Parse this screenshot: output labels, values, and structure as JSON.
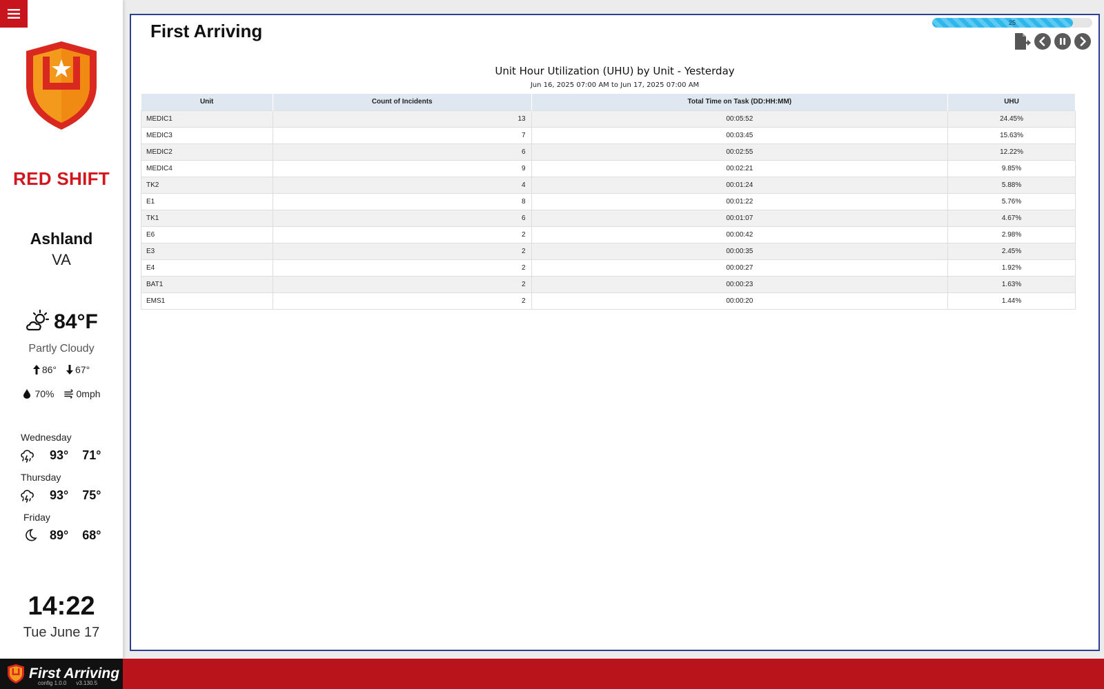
{
  "sidebar": {
    "shift": "RED SHIFT",
    "city": "Ashland",
    "state": "VA",
    "weather": {
      "temp": "84°F",
      "condition": "Partly Cloudy",
      "high": "86°",
      "low": "67°",
      "humidity": "70%",
      "wind": "0mph",
      "icon": "partly-cloudy-day-icon"
    },
    "forecast": [
      {
        "day": "Wednesday",
        "high": "93°",
        "low": "71°",
        "icon": "thunderstorm-icon"
      },
      {
        "day": "Thursday",
        "high": "93°",
        "low": "75°",
        "icon": "thunderstorm-icon"
      },
      {
        "day": "Friday",
        "high": "89°",
        "low": "68°",
        "icon": "moon-icon"
      }
    ],
    "time": "14:22",
    "date": "Tue June 17"
  },
  "header": {
    "title": "First Arriving",
    "progress_value": "25",
    "progress_fraction": 0.88
  },
  "report": {
    "title": "Unit Hour Utilization (UHU) by Unit - Yesterday",
    "subtitle": "Jun 16, 2025 07:00 AM to Jun 17, 2025 07:00 AM",
    "columns": [
      "Unit",
      "Count of Incidents",
      "Total Time on Task (DD:HH:MM)",
      "UHU"
    ],
    "rows": [
      [
        "MEDIC1",
        "13",
        "00:05:52",
        "24.45%"
      ],
      [
        "MEDIC3",
        "7",
        "00:03:45",
        "15.63%"
      ],
      [
        "MEDIC2",
        "6",
        "00:02:55",
        "12.22%"
      ],
      [
        "MEDIC4",
        "9",
        "00:02:21",
        "9.85%"
      ],
      [
        "TK2",
        "4",
        "00:01:24",
        "5.88%"
      ],
      [
        "E1",
        "8",
        "00:01:22",
        "5.76%"
      ],
      [
        "TK1",
        "6",
        "00:01:07",
        "4.67%"
      ],
      [
        "E6",
        "2",
        "00:00:42",
        "2.98%"
      ],
      [
        "E3",
        "2",
        "00:00:35",
        "2.45%"
      ],
      [
        "E4",
        "2",
        "00:00:27",
        "1.92%"
      ],
      [
        "BAT1",
        "2",
        "00:00:23",
        "1.63%"
      ],
      [
        "EMS1",
        "2",
        "00:00:20",
        "1.44%"
      ]
    ]
  },
  "footer": {
    "brand": "First Arriving",
    "config_version": "config 1.0.0",
    "app_version": "v3.130.5"
  },
  "colors": {
    "brand_red": "#c8141c",
    "shift_red": "#d2161e",
    "panel_border": "#2a3f8f",
    "progress": "#2fb6ea"
  }
}
